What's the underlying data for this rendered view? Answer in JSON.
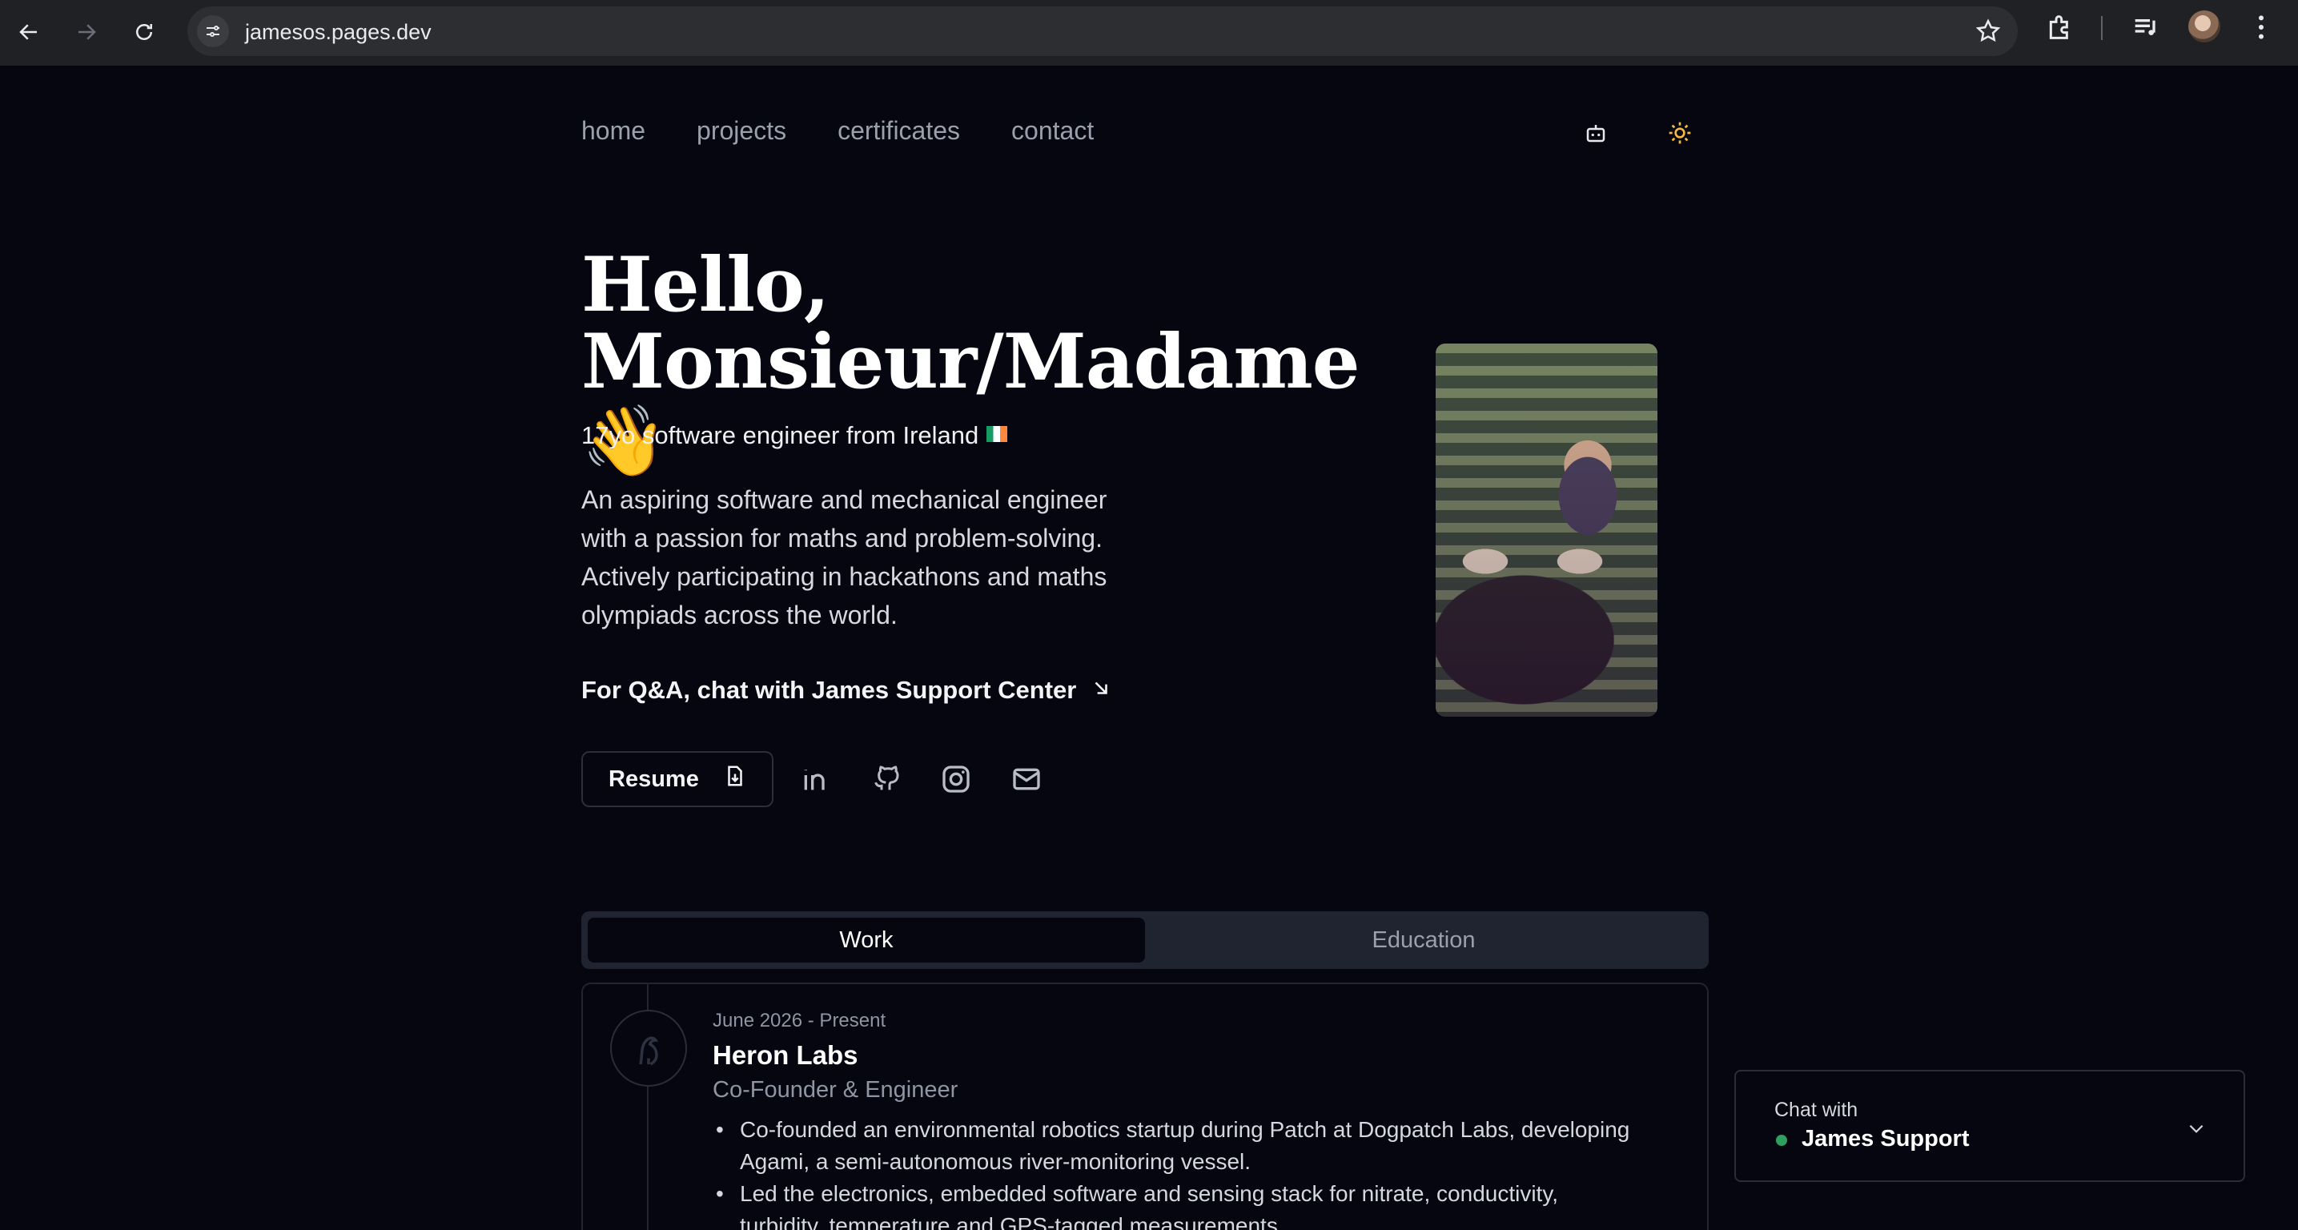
{
  "browser": {
    "url": "jamesos.pages.dev",
    "icons": [
      "back-arrow-icon",
      "forward-arrow-icon",
      "reload-icon",
      "site-settings-icon",
      "bookmark-star-icon",
      "extensions-icon",
      "media-controls-icon",
      "profile-avatar",
      "more-menu-icon"
    ]
  },
  "nav": {
    "items": [
      "home",
      "projects",
      "certificates",
      "contact"
    ],
    "icons": [
      "robot-icon",
      "sun-icon"
    ]
  },
  "hero": {
    "greeting_line1": "Hello,",
    "greeting_line2": "Monsieur/Madame",
    "wave_emoji": "👋",
    "subtitle": "17yo software engineer from Ireland",
    "bio": "An aspiring software and mechanical engineer with a passion for maths and problem-solving. Actively participating in hackathons and maths olympiads across the world.",
    "qa_text": "For Q&A, chat with James Support Center",
    "resume_label": "Resume"
  },
  "social": [
    "linkedin-icon",
    "github-icon",
    "instagram-icon",
    "mail-icon"
  ],
  "tabs": [
    {
      "label": "Work",
      "active": true
    },
    {
      "label": "Education",
      "active": false
    }
  ],
  "experience": [
    {
      "date": "June 2026 - Present",
      "company": "Heron Labs",
      "role": "Co-Founder & Engineer",
      "bullets": [
        "Co-founded an environmental robotics startup during Patch at Dogpatch Labs, developing Agami, a semi-autonomous river-monitoring vessel.",
        "Led the electronics, embedded software and sensing stack for nitrate, conductivity, turbidity, temperature and GPS-tagged measurements."
      ]
    }
  ],
  "chat": {
    "label": "Chat with",
    "name": "James Support",
    "status_color": "#2f9e5e"
  },
  "colors": {
    "background": "#05060f",
    "tab_bar": "#1f2430",
    "chrome": "#202124"
  }
}
